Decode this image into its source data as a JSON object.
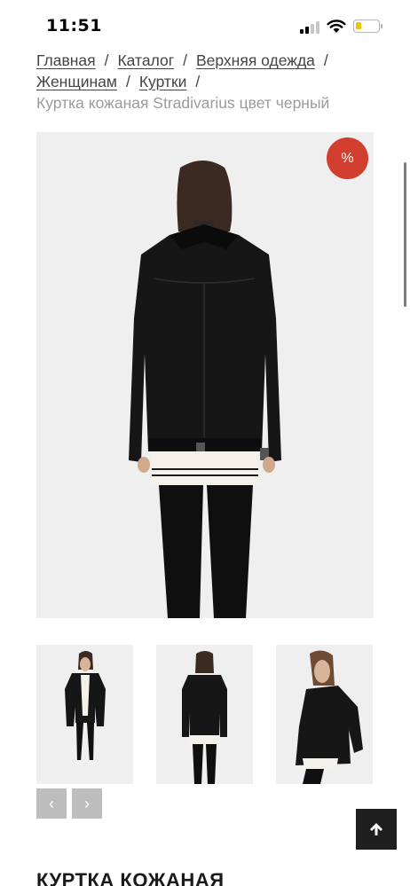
{
  "status_bar": {
    "time": "11:51",
    "signal_icon": "cellular-signal-icon",
    "wifi_icon": "wifi-icon",
    "battery_icon": "battery-icon",
    "battery_color": "#f2c200"
  },
  "breadcrumb": {
    "items": [
      {
        "label": "Главная"
      },
      {
        "label": "Каталог"
      },
      {
        "label": "Верхняя одежда"
      },
      {
        "label": "Женщинам"
      },
      {
        "label": "Куртки"
      }
    ],
    "separator": "/",
    "current": "Куртка кожаная Stradivarius цвет черный"
  },
  "product": {
    "sale_badge": "%",
    "sale_color": "#d23f2e",
    "title": "КУРТКА КОЖАНАЯ"
  },
  "gallery": {
    "prev_icon": "chevron-left-icon",
    "next_icon": "chevron-right-icon",
    "prev_symbol": "‹",
    "next_symbol": "›"
  },
  "scroll_to_top": {
    "icon": "arrow-up-icon"
  }
}
